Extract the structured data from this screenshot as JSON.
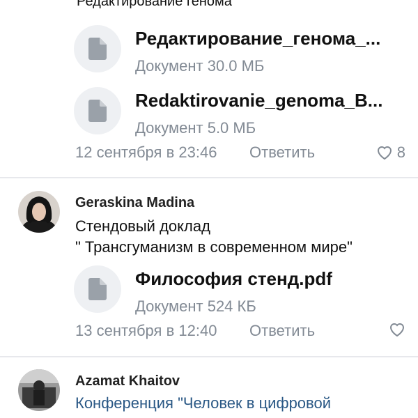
{
  "top_comment": {
    "text_tail": "Редактирование генома\"",
    "attachments": [
      {
        "name": "Редактирование_генома_...",
        "meta": "Документ 30.0 МБ",
        "icon": "document-icon"
      },
      {
        "name": "Redaktirovanie_genoma_B...",
        "meta": "Документ 5.0 МБ",
        "icon": "document-icon"
      }
    ],
    "timestamp": "12 сентября в 23:46",
    "reply_label": "Ответить",
    "likes": "8"
  },
  "comment2": {
    "author": "Geraskina Madina",
    "text_line1": "Стендовый доклад",
    "text_line2": "\" Трансгуманизм в современном мире\"",
    "attachment": {
      "name": "Философия стенд.pdf",
      "meta": "Документ 524 КБ",
      "icon": "document-icon"
    },
    "timestamp": "13 сентября в 12:40",
    "reply_label": "Ответить"
  },
  "comment3": {
    "author": "Azamat Khaitov",
    "text_link": "Конференция \"Человек в цифровой"
  },
  "colors": {
    "muted": "#828a94",
    "link": "#2a5885",
    "icon_bg": "#eef0f3",
    "divider": "#e7e8ec"
  }
}
